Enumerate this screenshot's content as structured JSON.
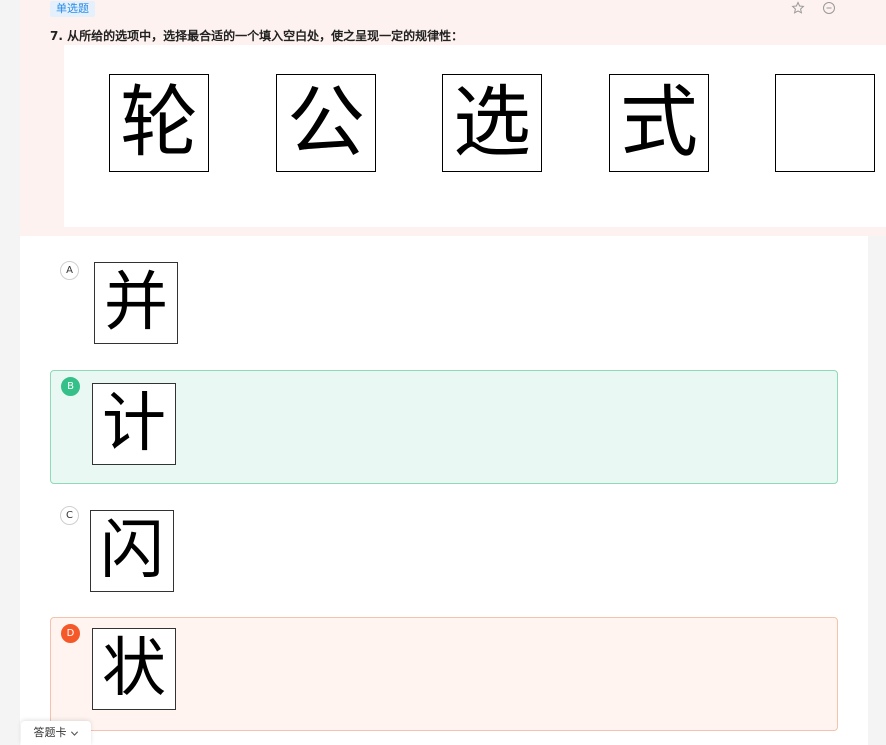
{
  "question": {
    "type_label": "单选题",
    "text": "7. 从所给的选项中，选择最合适的一个填入空白处，使之呈现一定的规律性：",
    "figure": [
      "轮",
      "公",
      "选",
      "式",
      ""
    ]
  },
  "toolbar": {
    "favorite_icon": "star-outline-icon",
    "remove_icon": "minus-circle-icon"
  },
  "options": [
    {
      "letter": "A",
      "char": "并",
      "state": "normal"
    },
    {
      "letter": "B",
      "char": "计",
      "state": "correct"
    },
    {
      "letter": "C",
      "char": "闪",
      "state": "normal"
    },
    {
      "letter": "D",
      "char": "状",
      "state": "wrong"
    }
  ],
  "footer": {
    "answer_card_label": "答题卡",
    "answer_card_icon": "chevron-down-icon"
  },
  "colors": {
    "correct": "#35c08a",
    "wrong": "#f5592a",
    "badge": "#2b8ce6"
  }
}
